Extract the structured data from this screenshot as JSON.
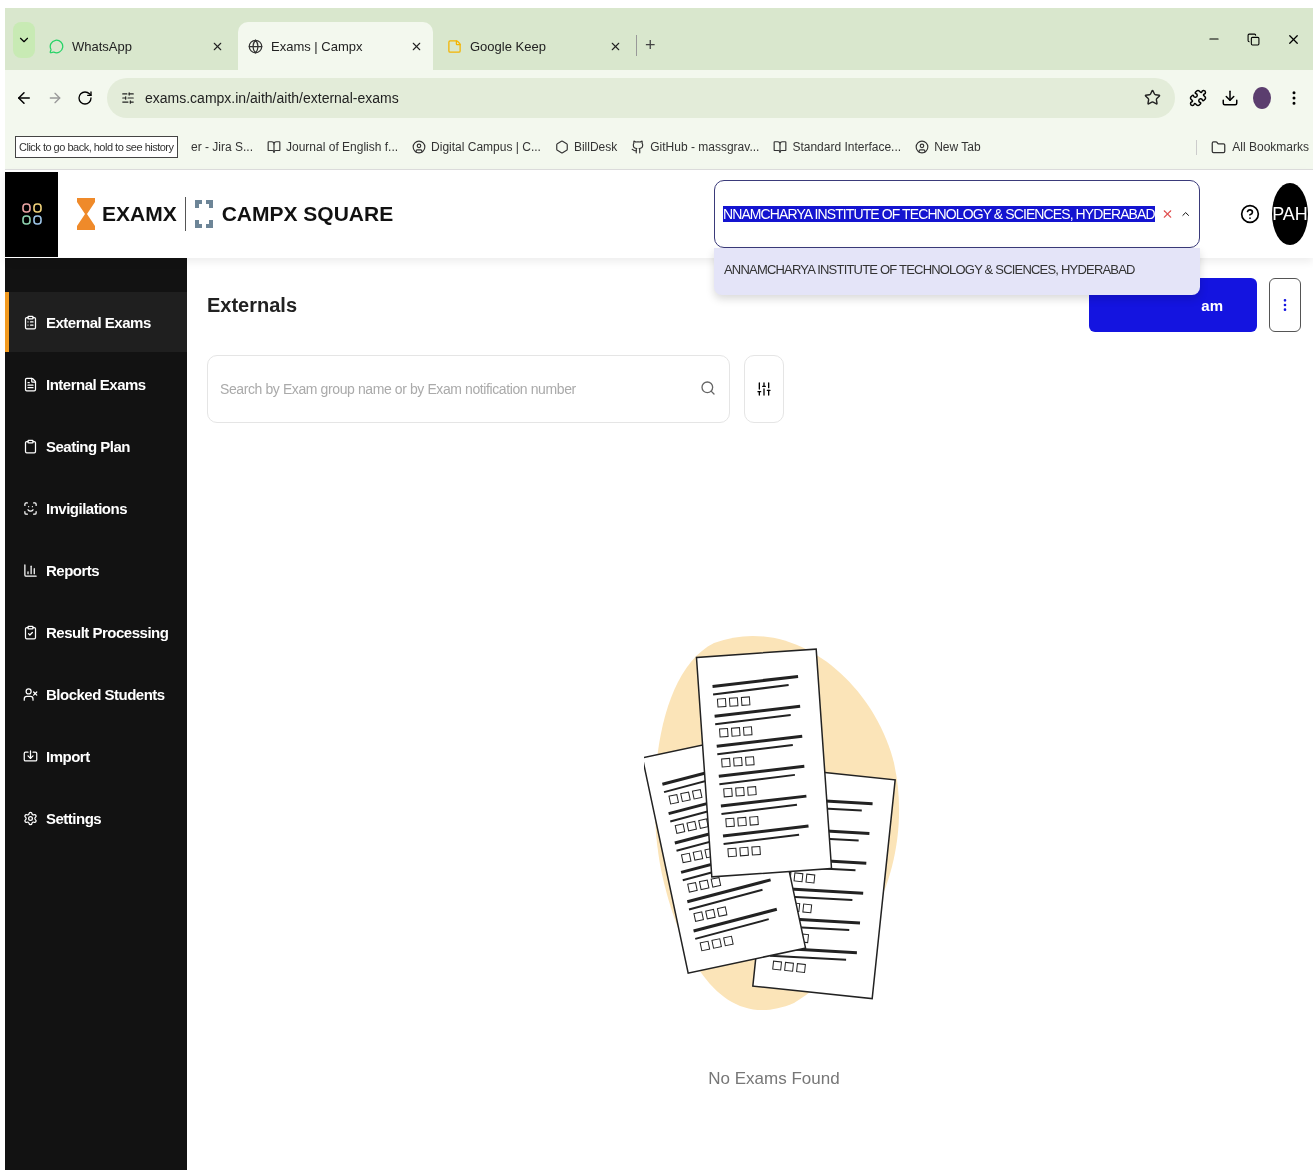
{
  "browser": {
    "tabs": [
      {
        "title": "WhatsApp",
        "selected": false
      },
      {
        "title": "Exams | Campx",
        "selected": true
      },
      {
        "title": "Google Keep",
        "selected": false
      }
    ],
    "new_tab": "+",
    "url": "exams.campx.in/aith/aith/external-exams",
    "tooltip": "Click to go back, hold to see history",
    "bookmarks": [
      "er - Jira S...",
      "Journal of English f...",
      "Digital Campus | C...",
      "BillDesk",
      "GitHub - massgrav...",
      "Standard Interface...",
      "New Tab"
    ],
    "all_bookmarks": "All Bookmarks"
  },
  "header": {
    "brand": "EXAMX",
    "partner": "CAMPX SQUARE",
    "institution_select": {
      "value": "NNAMCHARYA INSTITUTE OF TECHNOLOGY & SCIENCES, HYDERABAD",
      "expanded": true,
      "options": [
        {
          "label": "ANNAMCHARYA INSTITUTE OF TECHNOLOGY & SCIENCES, HYDERABAD",
          "selected": false
        }
      ]
    },
    "avatar": "PAH"
  },
  "sidebar": {
    "items": [
      {
        "label": "External Exams",
        "selected": true
      },
      {
        "label": "Internal Exams",
        "selected": false
      },
      {
        "label": "Seating Plan",
        "selected": false
      },
      {
        "label": "Invigilations",
        "selected": false
      },
      {
        "label": "Reports",
        "selected": false
      },
      {
        "label": "Result Processing",
        "selected": false
      },
      {
        "label": "Blocked Students",
        "selected": false
      },
      {
        "label": "Import",
        "selected": false
      },
      {
        "label": "Settings",
        "selected": false
      }
    ]
  },
  "main": {
    "title": "Externals",
    "primary_button": "am",
    "search": {
      "placeholder": "Search by Exam group name or by Exam notification number"
    },
    "empty_message": "No Exams Found"
  }
}
